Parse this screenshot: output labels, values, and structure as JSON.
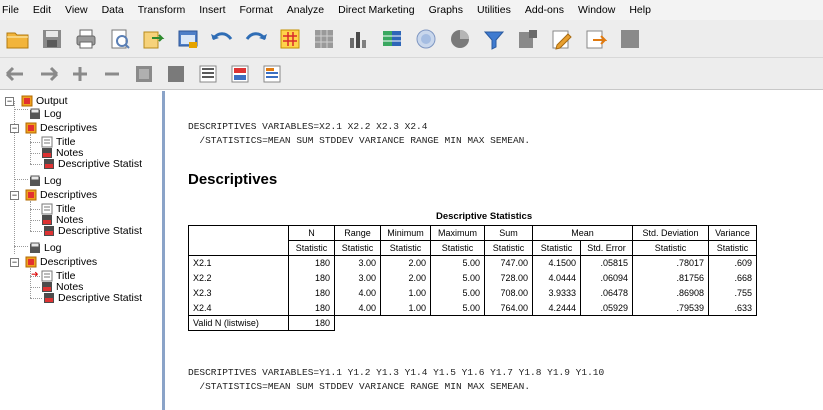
{
  "menu": [
    "File",
    "Edit",
    "View",
    "Data",
    "Transform",
    "Insert",
    "Format",
    "Analyze",
    "Direct Marketing",
    "Graphs",
    "Utilities",
    "Add-ons",
    "Window",
    "Help"
  ],
  "toolbar1": [
    "open-folder-icon",
    "save-icon",
    "print-icon",
    "print-preview-icon",
    "export-icon",
    "recall-dialog-icon",
    "undo-icon",
    "redo-icon",
    "goto-case-icon",
    "goto-variable-icon",
    "variables-icon",
    "insert-table-icon",
    "value-labels-icon",
    "chart-icon",
    "split-file-icon",
    "select-cases-icon",
    "edit-icon",
    "script-icon",
    "gray-icon"
  ],
  "toolbar2": [
    "promote-icon",
    "demote-icon",
    "expand-icon",
    "collapse-icon",
    "show-icon",
    "hide-icon",
    "insert-heading-icon",
    "insert-title-icon",
    "insert-text-icon"
  ],
  "outline": {
    "root": "Output",
    "nodes": [
      "Log",
      "Descriptives",
      "Title",
      "Notes",
      "Descriptive Statist",
      "Log",
      "Descriptives",
      "Title",
      "Notes",
      "Descriptive Statist",
      "Log",
      "Descriptives",
      "Title",
      "Notes",
      "Descriptive Statist"
    ]
  },
  "content": {
    "syntax1_line1": "DESCRIPTIVES VARIABLES=X2.1 X2.2 X2.3 X2.4",
    "syntax1_line2": "  /STATISTICS=MEAN SUM STDDEV VARIANCE RANGE MIN MAX SEMEAN.",
    "heading": "Descriptives",
    "table_title": "Descriptive Statistics",
    "syntax2_line1": "DESCRIPTIVES VARIABLES=Y1.1 Y1.2 Y1.3 Y1.4 Y1.5 Y1.6 Y1.7 Y1.8 Y1.9 Y1.10",
    "syntax2_line2": "  /STATISTICS=MEAN SUM STDDEV VARIANCE RANGE MIN MAX SEMEAN."
  },
  "table": {
    "headers": [
      "N",
      "Range",
      "Minimum",
      "Maximum",
      "Sum",
      "Mean",
      "Std. Deviation",
      "Variance"
    ],
    "subheaders": [
      "Statistic",
      "Statistic",
      "Statistic",
      "Statistic",
      "Statistic",
      "Statistic",
      "Std. Error",
      "Statistic",
      "Statistic"
    ],
    "rows": [
      [
        "X2.1",
        "180",
        "3.00",
        "2.00",
        "5.00",
        "747.00",
        "4.1500",
        ".05815",
        ".78017",
        ".609"
      ],
      [
        "X2.2",
        "180",
        "3.00",
        "2.00",
        "5.00",
        "728.00",
        "4.0444",
        ".06094",
        ".81756",
        ".668"
      ],
      [
        "X2.3",
        "180",
        "4.00",
        "1.00",
        "5.00",
        "708.00",
        "3.9333",
        ".06478",
        ".86908",
        ".755"
      ],
      [
        "X2.4",
        "180",
        "4.00",
        "1.00",
        "5.00",
        "764.00",
        "4.2444",
        ".05929",
        ".79539",
        ".633"
      ]
    ],
    "valid_label": "Valid N (listwise)",
    "valid_n": "180"
  }
}
